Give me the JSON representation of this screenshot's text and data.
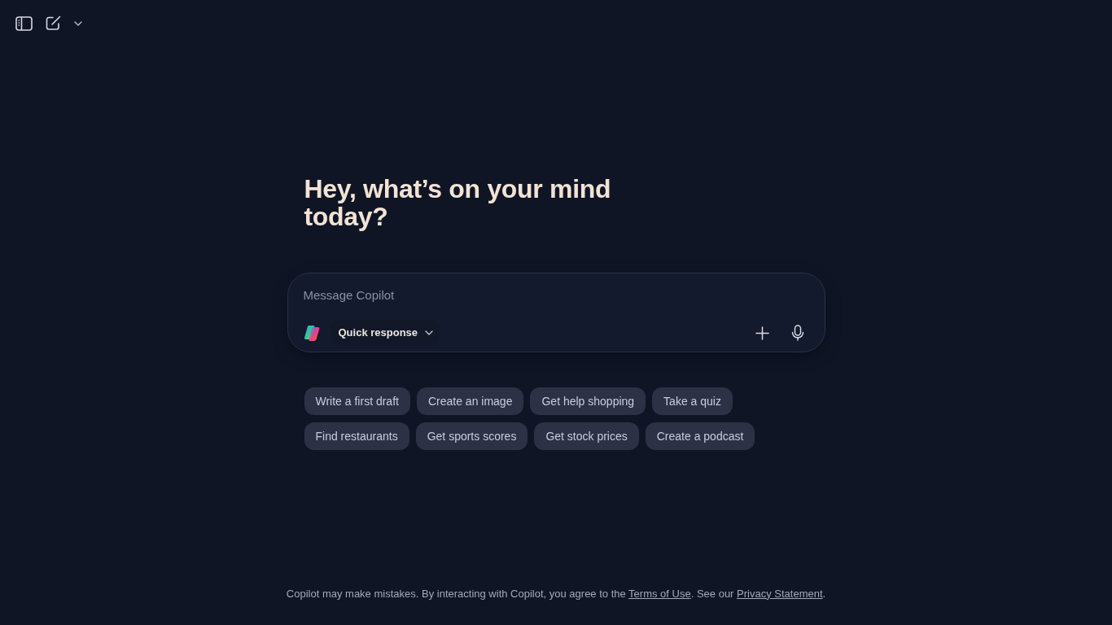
{
  "heading": "Hey, what’s on your mind today?",
  "composer": {
    "placeholder": "Message Copilot",
    "mode": "Quick response"
  },
  "suggestion_rows": [
    [
      "Write a first draft",
      "Create an image",
      "Get help shopping",
      "Take a quiz"
    ],
    [
      "Find restaurants",
      "Get sports scores",
      "Get stock prices",
      "Create a podcast"
    ]
  ],
  "footer": {
    "parts": [
      {
        "kind": "text",
        "text": "Copilot may make mistakes. By interacting with Copilot, you agree to the "
      },
      {
        "kind": "link",
        "text": "Terms of Use"
      },
      {
        "kind": "text",
        "text": ". See our "
      },
      {
        "kind": "link",
        "text": "Privacy Statement"
      },
      {
        "kind": "text",
        "text": "."
      }
    ]
  }
}
